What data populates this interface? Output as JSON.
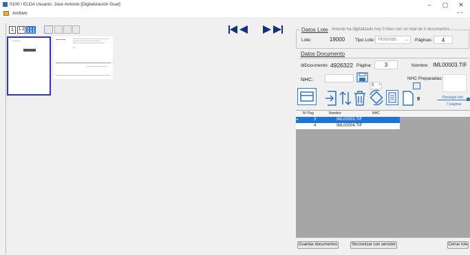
{
  "window": {
    "title": "0100 / ELDA Usuario: Jose Antonio   [Digitalización Gual]",
    "minimize": "–",
    "maximize": "▢",
    "close": "✕"
  },
  "menu": {
    "archivo": "Archivo",
    "restore": "– ▫"
  },
  "toolbar": {
    "view1": "1",
    "view2": "1 2"
  },
  "lote": {
    "title": "Datos Lote",
    "message": "Antonio ha digitalizado hoy 0 lotes con un total de 0 documentos",
    "lote_label": "Lote:",
    "lote_value": "19000",
    "tipo_label": "Tipo Lote:",
    "tipo_value": "Historias",
    "paginas_label": "Páginas:",
    "paginas_value": "4"
  },
  "documento": {
    "title": "Datos Documento",
    "id_label": "IdDocumento:",
    "id_value": "4926322",
    "pagina_label": "Página:",
    "pagina_value": "3",
    "nombre_label": "Nombre:",
    "nombre_value": "IML00003.TIF",
    "nhc_label": "NHC:",
    "nhc_value": "",
    "counter_value": "0",
    "nhc_preparadas_label": "NHC Preparadas:",
    "count_badge": "9",
    "recargar_label": "Recargar lote",
    "paginas_small": "7 páginas"
  },
  "table": {
    "columns": [
      "Nº Pag",
      "Nombre",
      "NHC"
    ],
    "rows": [
      {
        "pag": "3",
        "nombre": "IML00003.TIF",
        "nhc": "",
        "selected": true
      },
      {
        "pag": "4",
        "nombre": "IML00004.TIF",
        "nhc": "",
        "selected": false
      }
    ]
  },
  "buttons": {
    "guardar": "Guardar documentos",
    "sincronizar": "Sincronizar con servidor",
    "cerrar": "Cerrar lote"
  },
  "colors": {
    "accent": "#1e73d8",
    "selected_row": "#1e73d8",
    "grid_bg": "#a6a6a6",
    "nav_arrow": "#15317a"
  }
}
